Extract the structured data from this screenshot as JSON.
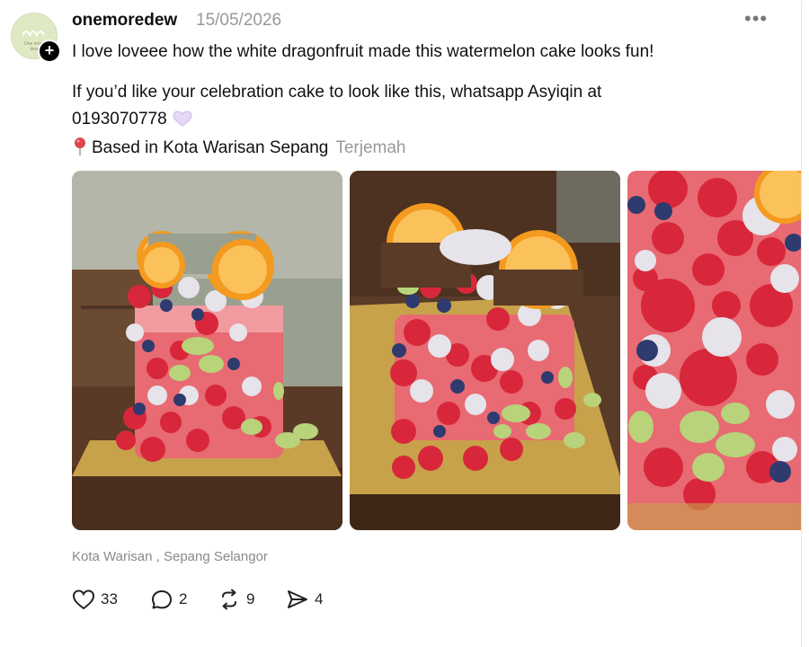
{
  "post": {
    "username": "onemoredew",
    "date": "15/05/2026",
    "more_label": "•••",
    "follow_symbol": "+",
    "avatar_text": "One more dew",
    "line1": "I love loveee how the white dragonfruit made this watermelon cake looks fun!",
    "line2": "If you’d like your celebration cake to look like this, whatsapp Asyiqin at",
    "line3": "0193070778",
    "line4": "Based in Kota Warisan Sepang",
    "translate_label": "Terjemah",
    "location": "Kota Warisan , Sepang Selangor"
  },
  "actions": {
    "likes": "33",
    "replies": "2",
    "reposts": "9",
    "shares": "4"
  },
  "icons": {
    "heart": "purple-heart-icon",
    "pin": "round-pushpin-icon"
  }
}
